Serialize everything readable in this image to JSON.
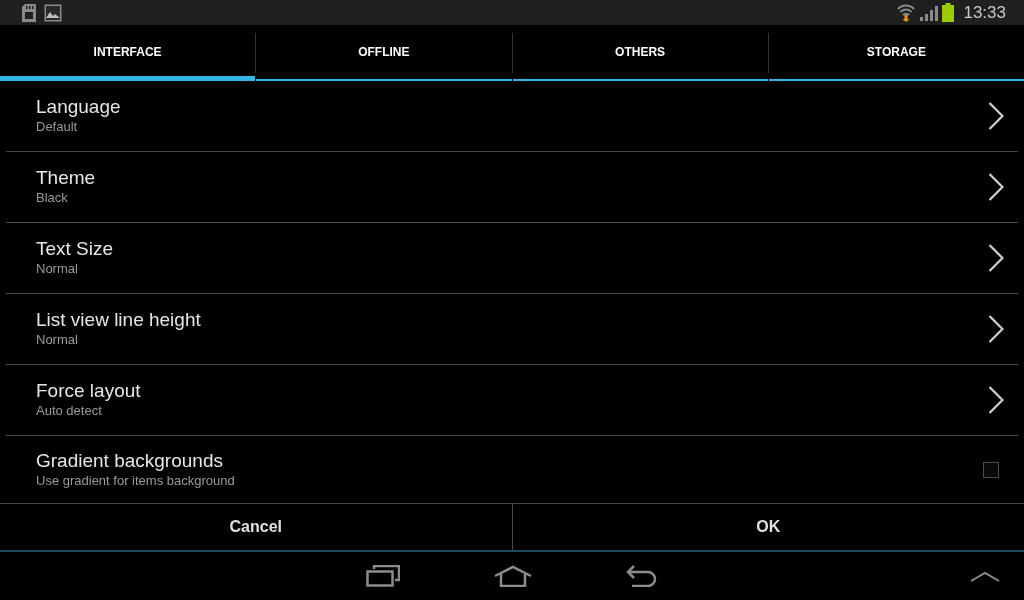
{
  "status_bar": {
    "time": "13:33"
  },
  "tabs": [
    {
      "label": "INTERFACE",
      "selected": true
    },
    {
      "label": "OFFLINE",
      "selected": false
    },
    {
      "label": "OTHERS",
      "selected": false
    },
    {
      "label": "STORAGE",
      "selected": false
    }
  ],
  "settings": [
    {
      "kind": "chooser",
      "title": "Language",
      "summary": "Default"
    },
    {
      "kind": "chooser",
      "title": "Theme",
      "summary": "Black"
    },
    {
      "kind": "chooser",
      "title": "Text Size",
      "summary": "Normal"
    },
    {
      "kind": "chooser",
      "title": "List view line height",
      "summary": "Normal"
    },
    {
      "kind": "chooser",
      "title": "Force layout",
      "summary": "Auto detect"
    },
    {
      "kind": "checkbox",
      "title": "Gradient backgrounds",
      "summary": "Use gradient for items background",
      "checked": false
    }
  ],
  "buttons": [
    {
      "label": "Cancel"
    },
    {
      "label": "OK"
    }
  ]
}
